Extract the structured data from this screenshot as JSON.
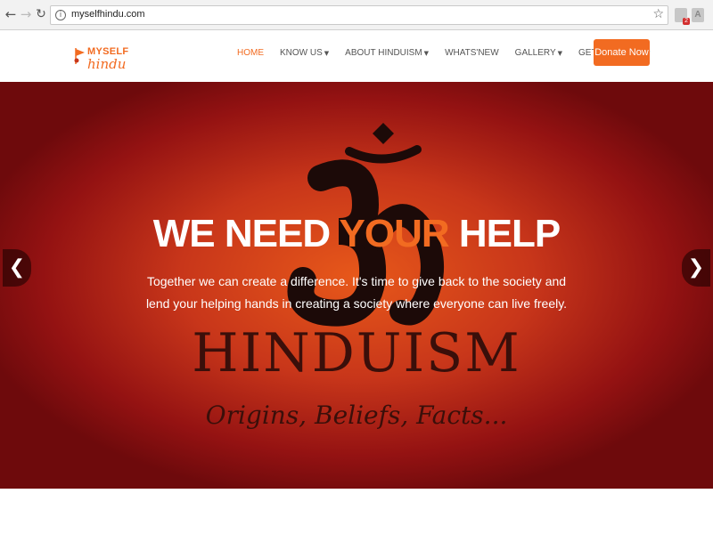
{
  "browser": {
    "url": "myselfhindu.com",
    "back_icon": "back-arrow-icon",
    "forward_icon": "forward-arrow-icon",
    "reload_icon": "reload-icon",
    "ext_badge": "2"
  },
  "site": {
    "logo_top": "MYSELF",
    "logo_bottom": "hindu",
    "nav": [
      {
        "label": "HOME",
        "dropdown": false,
        "active": true
      },
      {
        "label": "KNOW US",
        "dropdown": true
      },
      {
        "label": "ABOUT HINDUISM",
        "dropdown": true
      },
      {
        "label": "WHATS'NEW",
        "dropdown": false
      },
      {
        "label": "GALLERY",
        "dropdown": true
      },
      {
        "label": "GET INVOLVED",
        "dropdown": true
      }
    ],
    "donate_label": "Donate Now"
  },
  "hero": {
    "title_part1": "WE NEED ",
    "title_accent": "YOUR",
    "title_part2": " HELP",
    "subtitle": "Together we can create a difference. It's time to give back to the society and lend your helping hands in creating a society where everyone can live freely.",
    "image_word": "HINDUISM",
    "image_tagline": "Origins, Beliefs, Facts...",
    "prev_arrow": "❮",
    "next_arrow": "❯"
  },
  "colors": {
    "accent": "#f26b21",
    "hero_red": "#c8361a"
  }
}
